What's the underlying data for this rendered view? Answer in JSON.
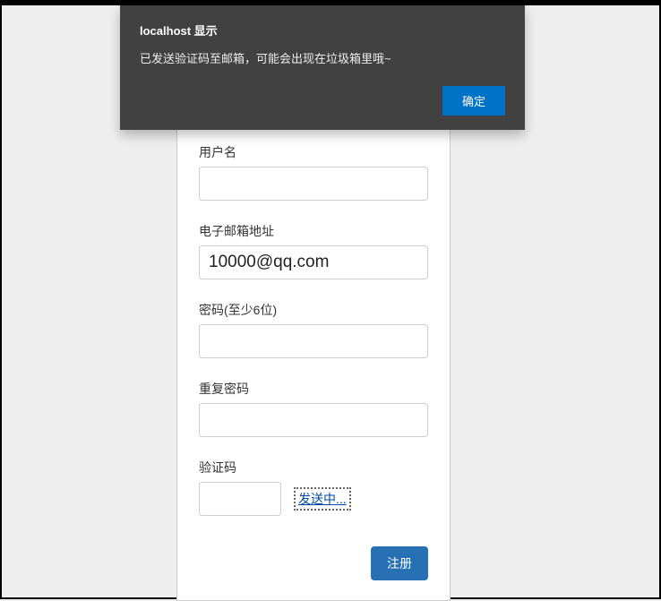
{
  "alert": {
    "title": "localhost 显示",
    "message": "已发送验证码至邮箱，可能会出现在垃圾箱里哦~",
    "ok_label": "确定"
  },
  "form": {
    "username": {
      "label": "用户名",
      "value": ""
    },
    "email": {
      "label": "电子邮箱地址",
      "value": "10000@qq.com"
    },
    "password": {
      "label": "密码(至少6位)",
      "value": ""
    },
    "confirm_password": {
      "label": "重复密码",
      "value": ""
    },
    "captcha": {
      "label": "验证码",
      "value": "",
      "send_label": "发送中..."
    },
    "submit_label": "注册"
  }
}
